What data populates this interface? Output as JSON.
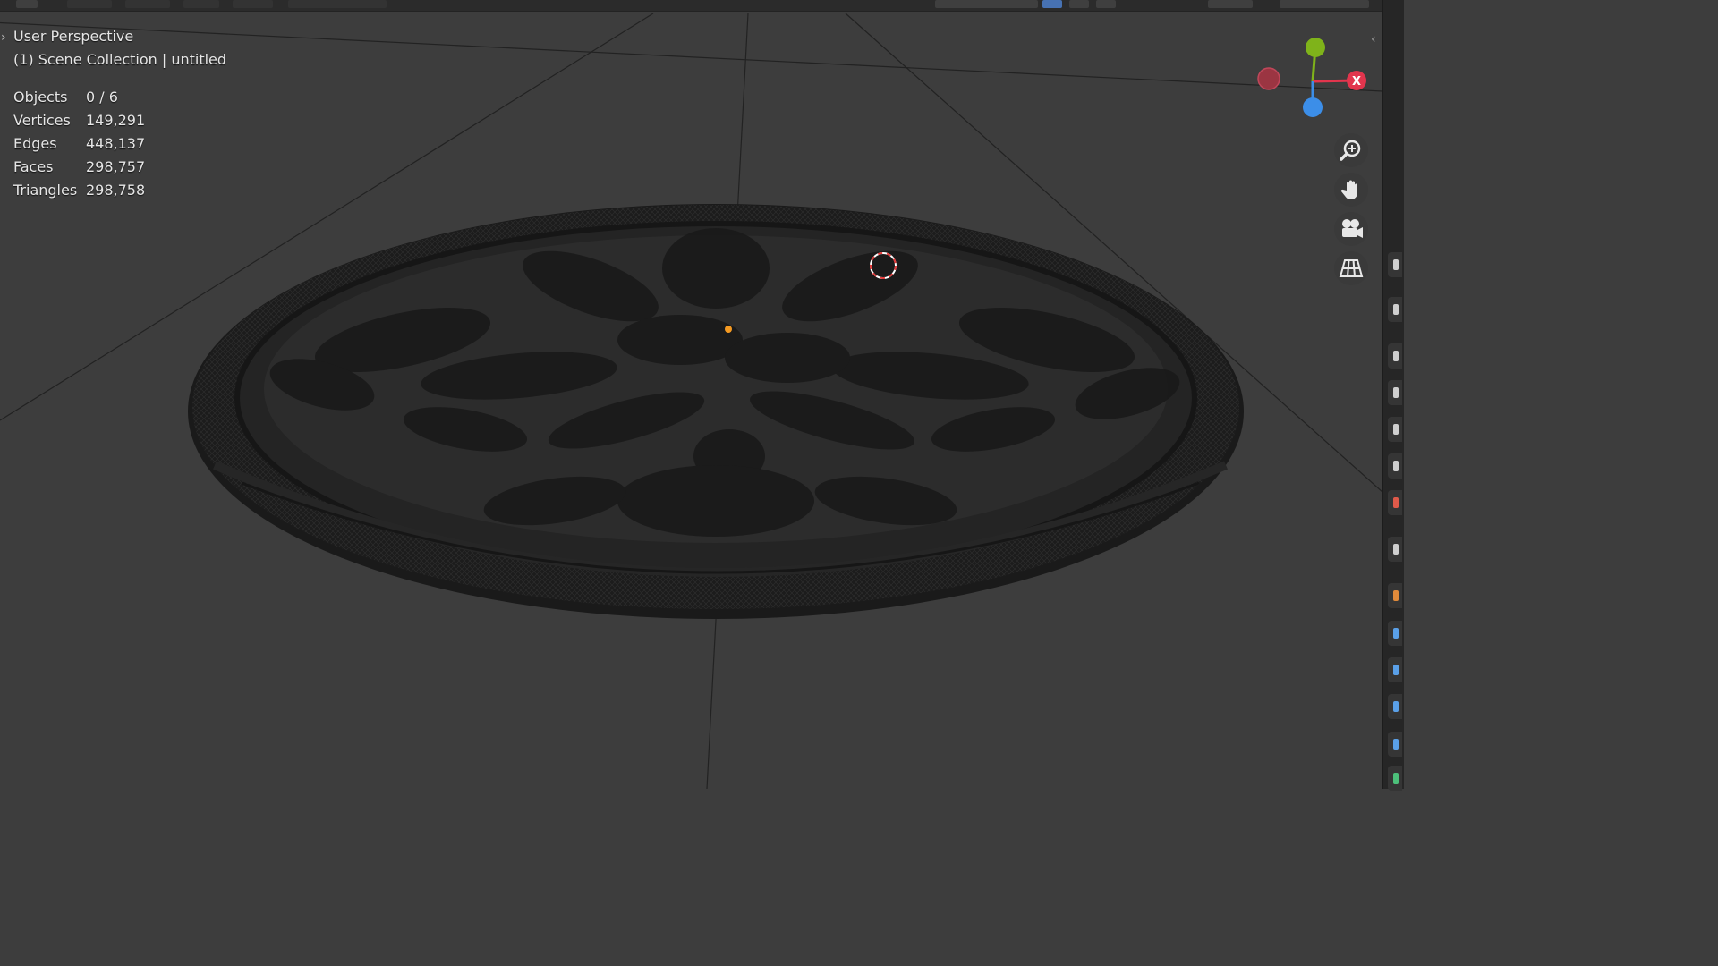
{
  "viewport": {
    "view_name": "User Perspective",
    "collection_label": "(1) Scene Collection | untitled"
  },
  "stats": [
    {
      "label": "Objects",
      "value": "0 / 6"
    },
    {
      "label": "Vertices",
      "value": "149,291"
    },
    {
      "label": "Edges",
      "value": "448,137"
    },
    {
      "label": "Faces",
      "value": "298,757"
    },
    {
      "label": "Triangles",
      "value": "298,758"
    }
  ],
  "gizmo": {
    "x_label": "X",
    "x_color": "#e2354d",
    "y_color": "#7fb31a",
    "z_color": "#3c8ee8"
  },
  "nav_buttons": [
    "zoom-icon",
    "hand-pan-icon",
    "camera-icon",
    "grid-perspective-icon"
  ],
  "colors": {
    "background": "#3d3d3d",
    "origin_dot": "#f59a22",
    "cursor_red": "#e23a3a"
  }
}
